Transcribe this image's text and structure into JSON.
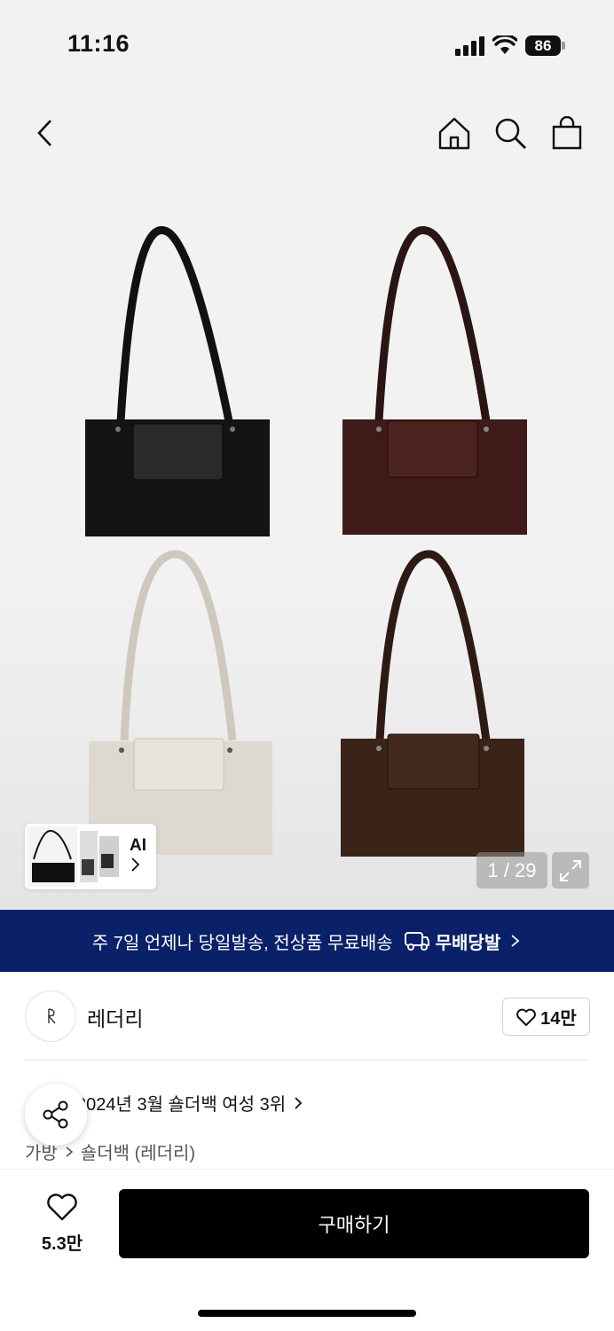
{
  "status_bar": {
    "time": "11:16",
    "battery": "86"
  },
  "gallery": {
    "counter": "1 / 29",
    "ai_label": "AI"
  },
  "banner": {
    "text": "주 7일 언제나 당일발송, 전상품 무료배송",
    "brand": "무배당발"
  },
  "brand": {
    "name": "레더리",
    "like_count": "14만"
  },
  "ranking": {
    "text": "2024년 3월 숄더백 여성 3위"
  },
  "category": {
    "parent": "가방",
    "child": "숄더백 (레더리)"
  },
  "bottom_bar": {
    "wish_count": "5.3만",
    "buy_label": "구매하기"
  },
  "colors": {
    "banner_bg": "#0a2068",
    "buy_bg": "#000000"
  }
}
